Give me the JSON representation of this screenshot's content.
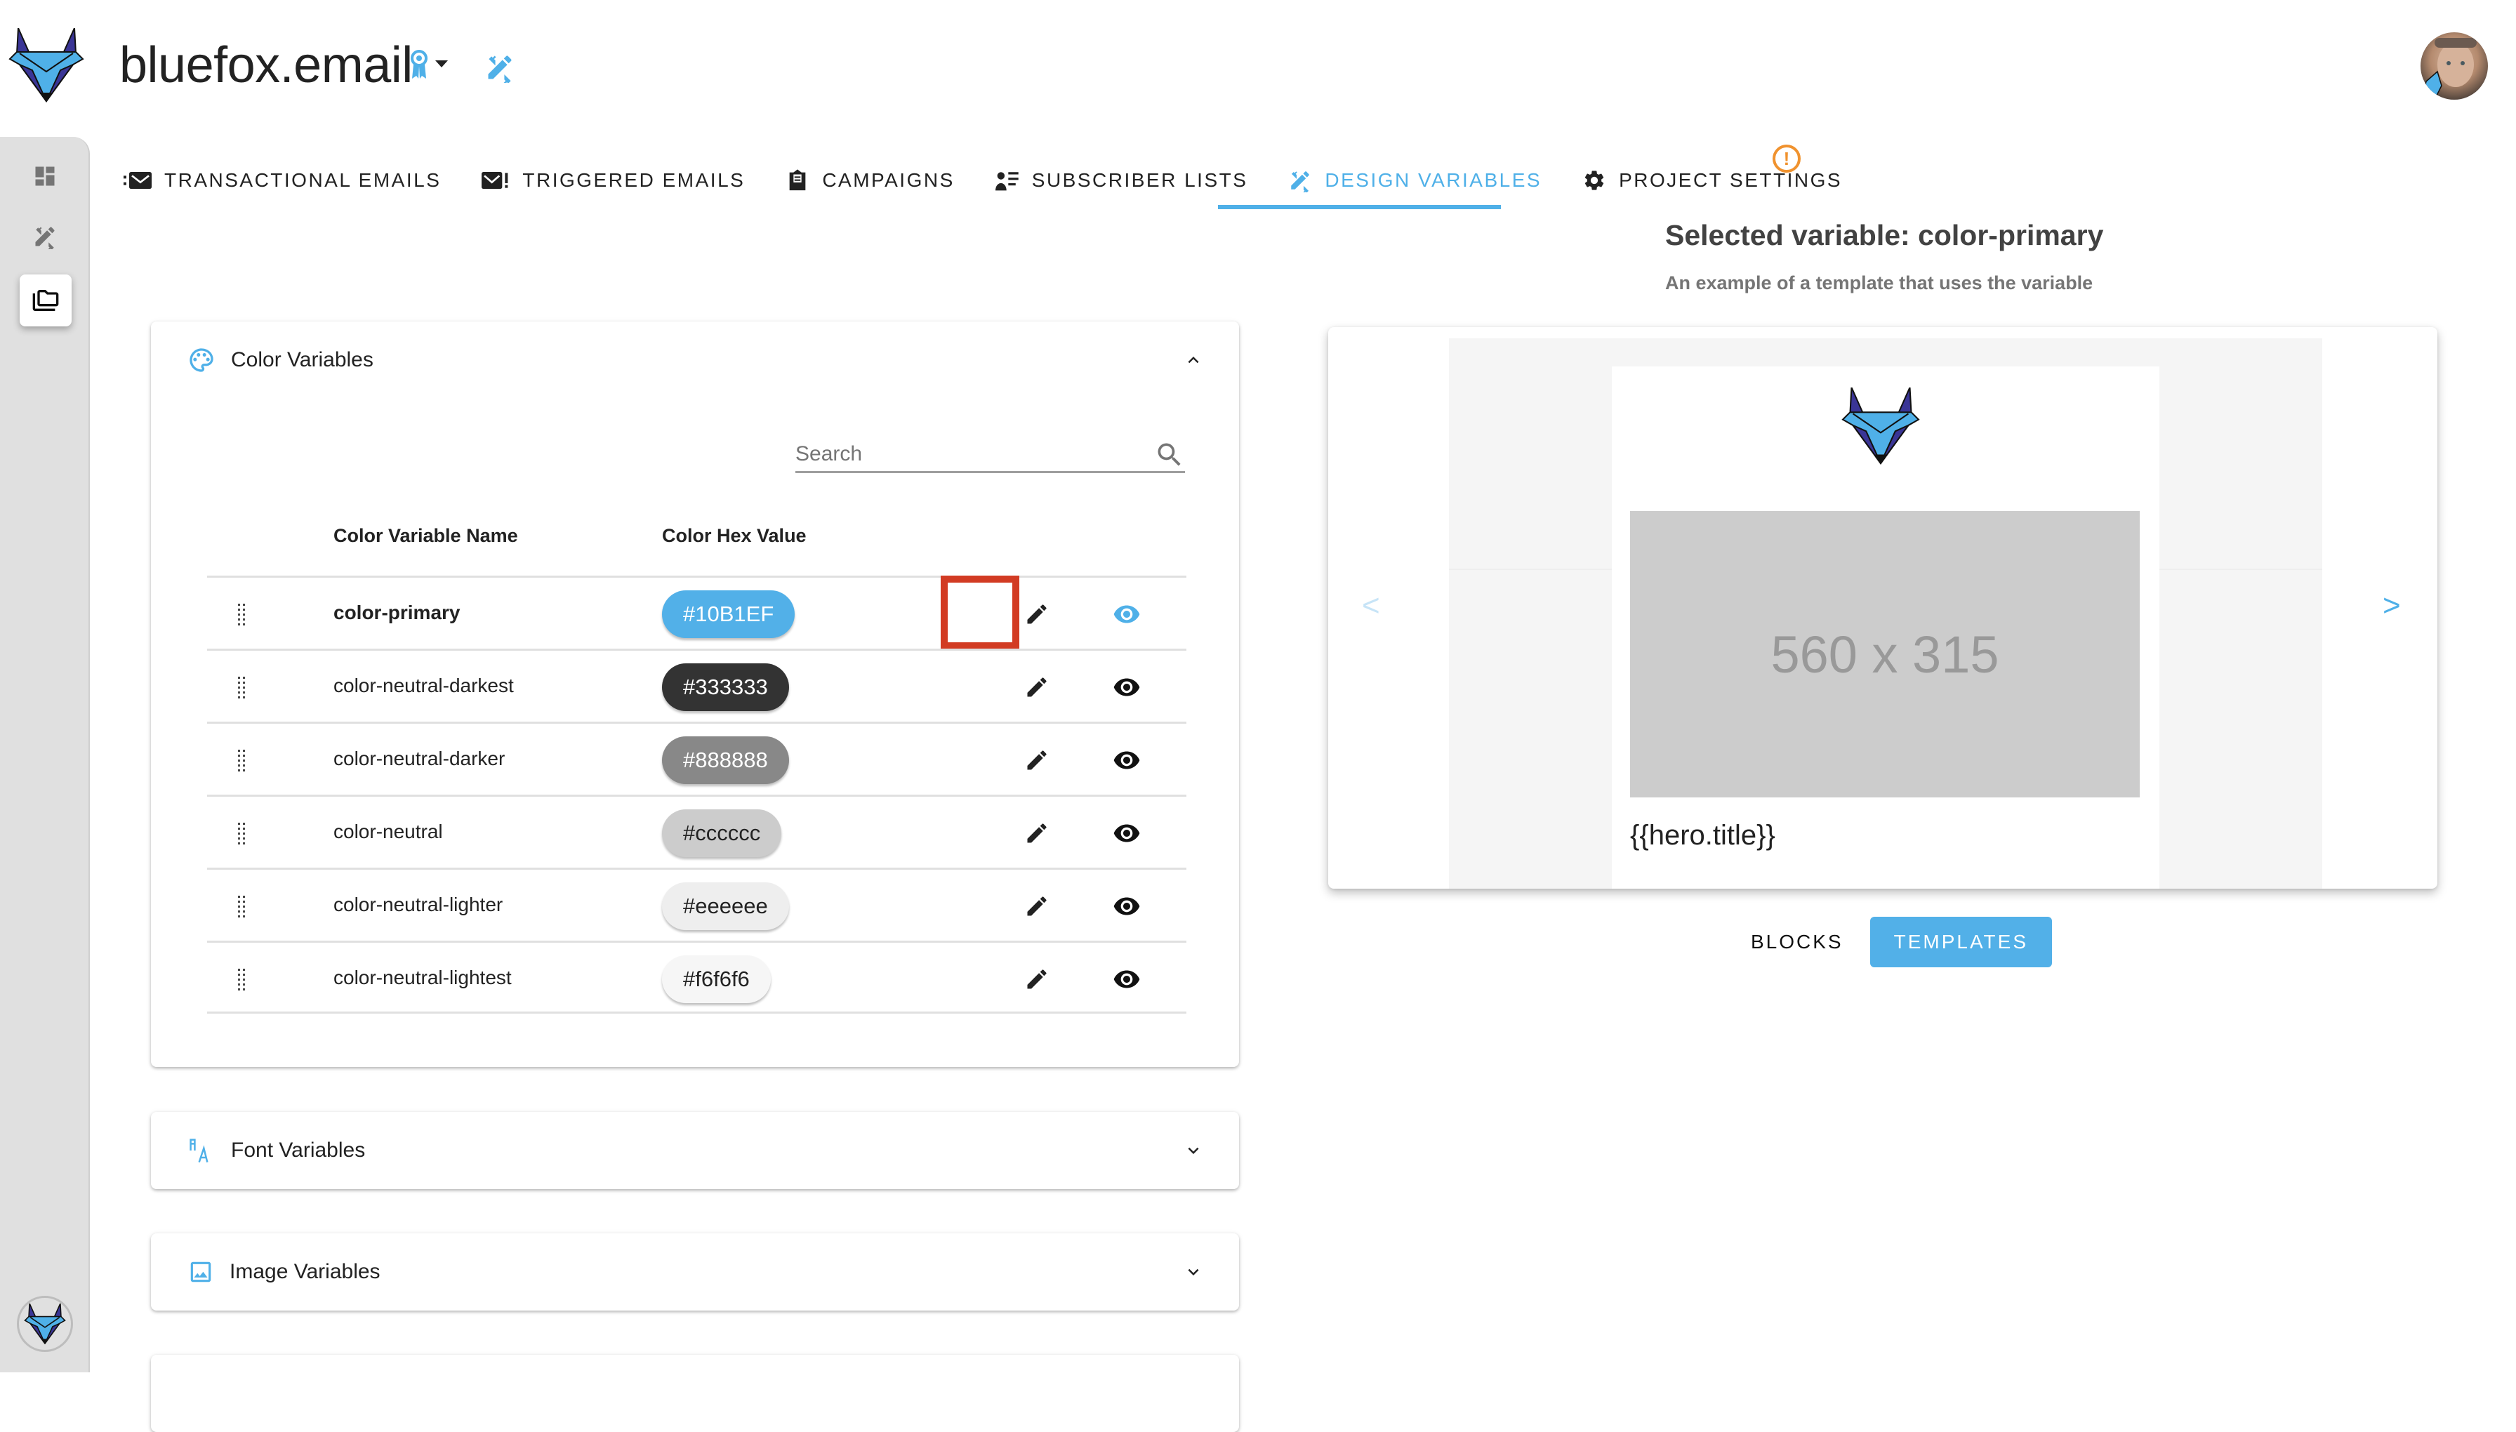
{
  "header": {
    "app_title": "bluefox.email",
    "badge_icon": "award-icon",
    "design_icon": "design-services-icon",
    "avatar_alt": "user avatar"
  },
  "sidebar": {
    "items": [
      {
        "icon": "dashboard-icon",
        "active": false
      },
      {
        "icon": "design-services-icon",
        "active": false
      },
      {
        "icon": "folder-copy-icon",
        "active": true
      }
    ],
    "bottom_logo": "bluefox-logo"
  },
  "tabs": [
    {
      "label": "TRANSACTIONAL EMAILS",
      "icon": "transactional-email-icon",
      "active": false
    },
    {
      "label": "TRIGGERED EMAILS",
      "icon": "triggered-email-icon",
      "active": false
    },
    {
      "label": "CAMPAIGNS",
      "icon": "campaign-icon",
      "active": false
    },
    {
      "label": "SUBSCRIBER LISTS",
      "icon": "subscriber-list-icon",
      "active": false
    },
    {
      "label": "DESIGN VARIABLES",
      "icon": "design-services-icon",
      "active": true
    },
    {
      "label": "PROJECT SETTINGS",
      "icon": "gear-icon",
      "active": false
    }
  ],
  "warning_badge": "!",
  "color_section": {
    "title": "Color Variables",
    "expanded": true,
    "search": {
      "placeholder": "Search",
      "value": ""
    },
    "columns": [
      "Color Variable Name",
      "Color Hex Value"
    ],
    "rows": [
      {
        "name": "color-primary",
        "hex": "#10B1EF",
        "chip_bg": "#52b0e8",
        "chip_fg": "#ffffff",
        "selected": true
      },
      {
        "name": "color-neutral-darkest",
        "hex": "#333333",
        "chip_bg": "#333333",
        "chip_fg": "#ffffff",
        "selected": false
      },
      {
        "name": "color-neutral-darker",
        "hex": "#888888",
        "chip_bg": "#888888",
        "chip_fg": "#ffffff",
        "selected": false
      },
      {
        "name": "color-neutral",
        "hex": "#cccccc",
        "chip_bg": "#cccccc",
        "chip_fg": "#222222",
        "selected": false
      },
      {
        "name": "color-neutral-lighter",
        "hex": "#eeeeee",
        "chip_bg": "#eeeeee",
        "chip_fg": "#222222",
        "selected": false
      },
      {
        "name": "color-neutral-lightest",
        "hex": "#f6f6f6",
        "chip_bg": "#f6f6f6",
        "chip_fg": "#222222",
        "selected": false
      }
    ]
  },
  "font_section": {
    "title": "Font Variables",
    "expanded": false
  },
  "image_section": {
    "title": "Image Variables",
    "expanded": false
  },
  "preview": {
    "title": "Selected variable: color-primary",
    "subtitle": "An example of a template that uses the variable",
    "placeholder_text": "560 x 315",
    "hero_title": "{{hero.title}}",
    "prev_label": "<",
    "next_label": ">"
  },
  "view_toggle": {
    "options": [
      "BLOCKS",
      "TEMPLATES"
    ],
    "selected": "TEMPLATES"
  },
  "colors": {
    "accent": "#4fb0e8",
    "warning": "#f0922e",
    "highlight": "#d23b23"
  }
}
